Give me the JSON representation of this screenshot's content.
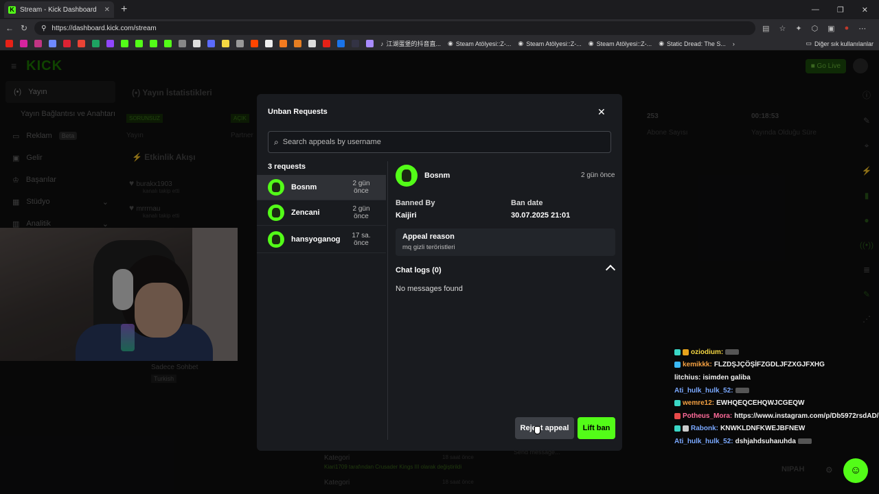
{
  "browser": {
    "tab_title": "Stream - Kick Dashboard",
    "url": "https://dashboard.kick.com/stream",
    "bookmarks": [
      {
        "label": "江湖蛋堡的抖音直...",
        "icon": "tiktok-icon"
      },
      {
        "label": "Steam Atölyesi::Z-...",
        "icon": "steam-icon"
      },
      {
        "label": "Steam Atölyesi::Z-...",
        "icon": "steam-icon"
      },
      {
        "label": "Steam Atölyesi::Z-...",
        "icon": "steam-icon"
      },
      {
        "label": "Static Dread: The S...",
        "icon": "steam-icon"
      }
    ],
    "other_bookmarks": "Diğer sık kullanılanlar"
  },
  "sidebar": {
    "items": [
      {
        "label": "Yayın",
        "icon": "broadcast-icon"
      },
      {
        "label": "Yayın Bağlantısı ve Anahtarı",
        "icon": ""
      },
      {
        "label": "Reklam",
        "icon": "ad-icon",
        "badge": "Beta"
      },
      {
        "label": "Gelir",
        "icon": "wallet-icon"
      },
      {
        "label": "Başarılar",
        "icon": "trophy-icon"
      },
      {
        "label": "Stüdyo",
        "icon": "studio-icon"
      },
      {
        "label": "Analitik",
        "icon": "chart-icon"
      }
    ]
  },
  "background": {
    "stats_title": "Yayın İstatistikleri",
    "status1": "SORUNSUZ",
    "status1_label": "Yayın",
    "status2": "AÇIK",
    "status2_label": "Partner",
    "subs_value": "253",
    "subs_label": "Abone Sayısı",
    "uptime_value": "00:18:53",
    "uptime_label": "Yayında Olduğu Süre",
    "activity_title": "Etkinlik Akışı",
    "activity": [
      {
        "user": "burakx1903",
        "sub": "kanalı takip etti"
      },
      {
        "user": "mrrrnau",
        "sub": "kanalı takip etti"
      }
    ],
    "category_label": "Sadece Sohbet",
    "category_lang": "Turkish",
    "feed_title1": "Kategori",
    "feed_text1": "Kiari1709 tarafından Crusader Kings III olarak değiştirildi",
    "feed_time1": "18 saat önce",
    "feed_title2": "Kategori",
    "feed_time2": "18 saat önce",
    "chat_placeholder": "Send message..."
  },
  "chat": [
    {
      "user": "oziodium:",
      "msg": "",
      "color": "#f5d742"
    },
    {
      "user": "kemikkk:",
      "msg": "FLZDŞJÇÖŞİFZGDLJFZXGJFXHG",
      "color": "#f5a142"
    },
    {
      "user": "litchius:",
      "msg": "isimden galiba",
      "color": "#ffffff"
    },
    {
      "user": "Ati_hulk_hulk_52:",
      "msg": "",
      "color": "#7aa8ff"
    },
    {
      "user": "wemre12:",
      "msg": "EWHQEQCEHQWJCGEQW",
      "color": "#f5a142"
    },
    {
      "user": "Potheus_Mora:",
      "msg": "https://www.instagram.com/p/Db5972rsdAD/",
      "color": "#ff6b9a"
    },
    {
      "user": "Rabonk:",
      "msg": "KNWKLDNFKWEJBFNEW",
      "color": "#7aa8ff"
    },
    {
      "user": "Ati_hulk_hulk_52:",
      "msg": "dshjahdsuhaıuhda",
      "color": "#7aa8ff"
    }
  ],
  "modal": {
    "title": "Unban Requests",
    "search_placeholder": "Search appeals by username",
    "count_label": "3 requests",
    "requests": [
      {
        "name": "Bosnm",
        "time": "2 gün önce"
      },
      {
        "name": "Zencani",
        "time": "2 gün önce"
      },
      {
        "name": "hansyoganog",
        "time": "17 sa. önce"
      }
    ],
    "detail": {
      "name": "Bosnm",
      "time": "2 gün önce",
      "banned_by_label": "Banned By",
      "banned_by": "Kaijiri",
      "ban_date_label": "Ban date",
      "ban_date": "30.07.2025 21:01",
      "appeal_reason_label": "Appeal reason",
      "appeal_reason": "mq gizli teröristleri",
      "chat_logs_label": "Chat logs (0)",
      "no_messages": "No messages found"
    },
    "reject_label": "Reject appeal",
    "lift_label": "Lift ban"
  },
  "colors": {
    "accent": "#53fc18",
    "modal_bg": "#191b1f"
  }
}
